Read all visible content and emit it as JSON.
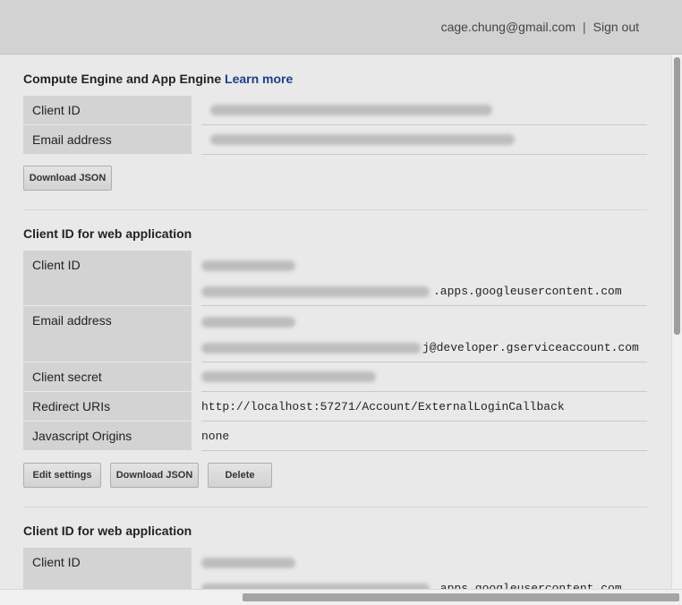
{
  "header": {
    "account_email": "cage.chung@gmail.com",
    "separator": "|",
    "signout_label": "Sign out"
  },
  "sections": {
    "compute": {
      "title": "Compute Engine and App Engine",
      "learn_more": "Learn more",
      "client_id_label": "Client ID",
      "email_label": "Email address",
      "download_label": "Download JSON"
    },
    "web1": {
      "title": "Client ID for web application",
      "client_id_label": "Client ID",
      "client_id_suffix": ".apps.googleusercontent.com",
      "email_label": "Email address",
      "email_suffix": "j@developer.gserviceaccount.com",
      "secret_label": "Client secret",
      "redirect_label": "Redirect URIs",
      "redirect_value": "http://localhost:57271/Account/ExternalLoginCallback",
      "origins_label": "Javascript Origins",
      "origins_value": "none",
      "edit_label": "Edit settings",
      "download_label": "Download JSON",
      "delete_label": "Delete"
    },
    "web2": {
      "title": "Client ID for web application",
      "client_id_label": "Client ID",
      "client_id_suffix": ".apps.googleusercontent.com"
    }
  }
}
